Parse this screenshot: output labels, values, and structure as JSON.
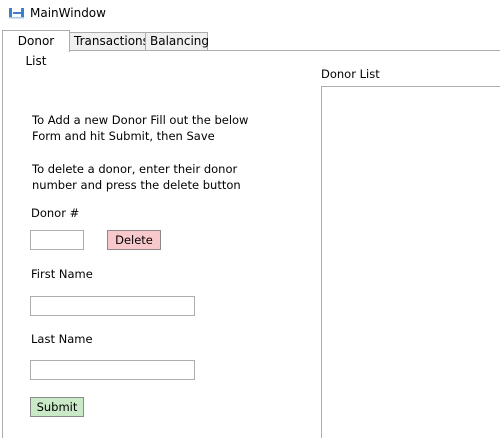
{
  "window": {
    "title": "MainWindow",
    "icon": "app-window-icon"
  },
  "tabs": [
    {
      "label": "Donor List",
      "selected": true
    },
    {
      "label": "Transactions",
      "selected": false
    },
    {
      "label": "Balancing",
      "selected": false
    }
  ],
  "instructions": {
    "add_line1": "To Add a new Donor Fill out the below",
    "add_line2": "Form and hit Submit, then Save",
    "delete_line1": "To delete a donor, enter their donor",
    "delete_line2": "number and press the delete button"
  },
  "form": {
    "donor_number_label": "Donor #",
    "donor_number_value": "",
    "delete_label": "Delete",
    "first_name_label": "First Name",
    "first_name_value": "",
    "last_name_label": "Last Name",
    "last_name_value": "",
    "submit_label": "Submit"
  },
  "donor_list": {
    "label": "Donor List",
    "items": []
  },
  "colors": {
    "delete_button": "#f9c8cd",
    "submit_button": "#c9e9c7"
  }
}
